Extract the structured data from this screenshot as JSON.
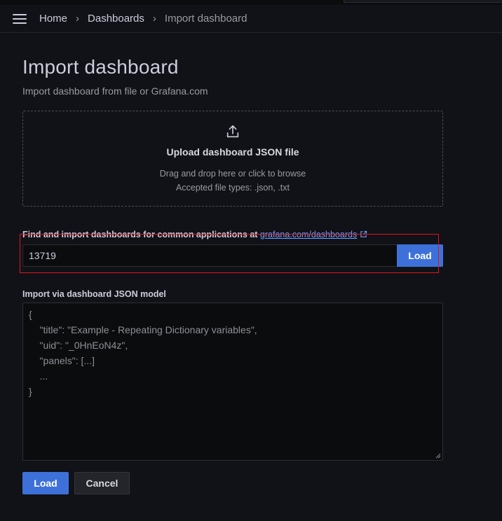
{
  "breadcrumb": {
    "items": [
      "Home",
      "Dashboards",
      "Import dashboard"
    ]
  },
  "page": {
    "title": "Import dashboard",
    "subtitle": "Import dashboard from file or Grafana.com"
  },
  "upload": {
    "title": "Upload dashboard JSON file",
    "hint": "Drag and drop here or click to browse",
    "accepted": "Accepted file types: .json, .txt"
  },
  "grafana_import": {
    "label_text": "Find and import dashboards for common applications at ",
    "link_text": "grafana.com/dashboards",
    "input_value": "13719",
    "load_label": "Load"
  },
  "json_model": {
    "label": "Import via dashboard JSON model",
    "placeholder_lines": [
      "{",
      "    \"title\": \"Example - Repeating Dictionary variables\",",
      "    \"uid\": \"_0HnEoN4z\",",
      "    \"panels\": [...]",
      "    ...",
      "}"
    ]
  },
  "actions": {
    "load_label": "Load",
    "cancel_label": "Cancel"
  },
  "colors": {
    "background": "#111217",
    "primary": "#3d71d9",
    "link": "#6e9fff",
    "highlight": "#e0141e"
  }
}
